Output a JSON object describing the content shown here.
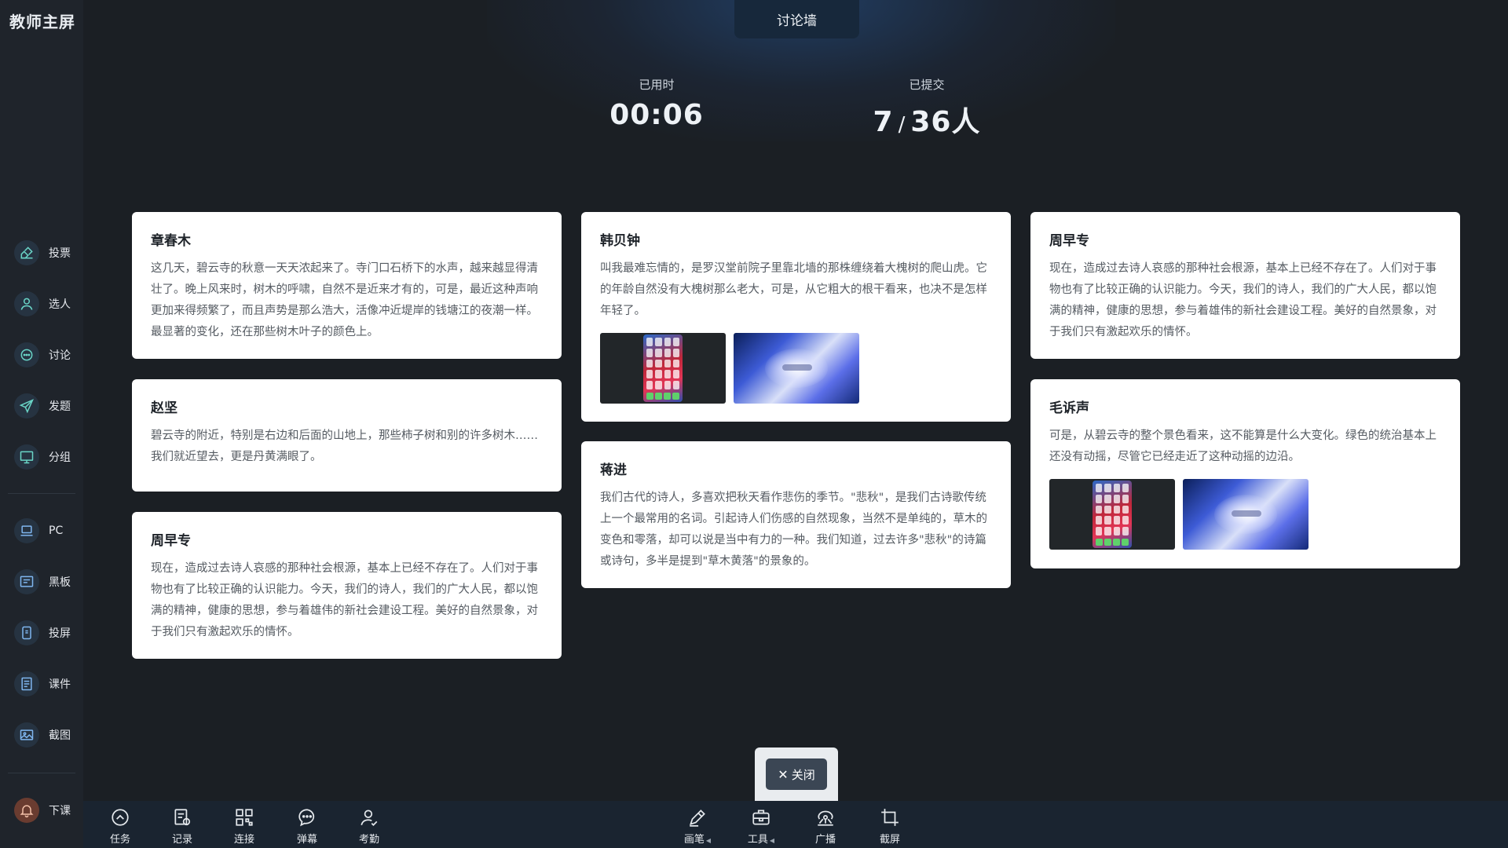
{
  "sidebar": {
    "brand": "教师主屏",
    "items": [
      {
        "label": "投票",
        "icon": "vote-icon"
      },
      {
        "label": "选人",
        "icon": "person-icon"
      },
      {
        "label": "讨论",
        "icon": "chat-icon"
      },
      {
        "label": "发题",
        "icon": "send-icon"
      },
      {
        "label": "分组",
        "icon": "monitor-icon"
      },
      {
        "label": "PC",
        "icon": "laptop-icon"
      },
      {
        "label": "黑板",
        "icon": "blackboard-icon"
      },
      {
        "label": "投屏",
        "icon": "cast-icon"
      },
      {
        "label": "课件",
        "icon": "courseware-icon"
      },
      {
        "label": "截图",
        "icon": "image-icon"
      }
    ],
    "end_class": {
      "label": "下课",
      "icon": "bell-icon"
    }
  },
  "header": {
    "title": "讨论墙",
    "elapsed_label": "已用时",
    "elapsed_value": "00:06",
    "submitted_label": "已提交",
    "submitted_count": "7",
    "submitted_sep": "/",
    "submitted_total": "36人"
  },
  "cards": [
    {
      "name": "章春木",
      "text": "这几天，碧云寺的秋意一天天浓起来了。寺门口石桥下的水声，越来越显得清壮了。晚上风来时，树木的呼啸，自然不是近来才有的，可是，最近这种声响更加来得频繁了，而且声势是那么浩大，活像冲近堤岸的钱塘江的夜潮一样。最显著的变化，还在那些树木叶子的颜色上。"
    },
    {
      "name": "赵坚",
      "text": "碧云寺的附近，特别是右边和后面的山地上，那些柿子树和别的许多树木……我们就近望去，更是丹黄满眼了。"
    },
    {
      "name": "周早专",
      "text": "现在，造成过去诗人哀感的那种社会根源，基本上已经不存在了。人们对于事物也有了比较正确的认识能力。今天，我们的诗人，我们的广大人民，都以饱满的精神，健康的思想，参与着雄伟的新社会建设工程。美好的自然景象，对于我们只有激起欢乐的情怀。"
    },
    {
      "name": "韩贝钟",
      "text": "叫我最难忘情的，是罗汉堂前院子里靠北墙的那株缠绕着大槐树的爬山虎。它的年龄自然没有大槐树那么老大，可是，从它粗大的根干看来，也决不是怎样年轻了。"
    },
    {
      "name": "蒋进",
      "text": "我们古代的诗人，多喜欢把秋天看作悲伤的季节。\"悲秋\"，是我们古诗歌传统上一个最常用的名词。引起诗人们伤感的自然现象，当然不是单纯的，草木的变色和零落，却可以说是当中有力的一种。我们知道，过去许多\"悲秋\"的诗篇或诗句，多半是提到\"草木黄落\"的景象的。"
    },
    {
      "name": "周早专",
      "text": "现在，造成过去诗人哀感的那种社会根源，基本上已经不存在了。人们对于事物也有了比较正确的认识能力。今天，我们的诗人，我们的广大人民，都以饱满的精神，健康的思想，参与着雄伟的新社会建设工程。美好的自然景象，对于我们只有激起欢乐的情怀。"
    },
    {
      "name": "毛诉声",
      "text": "可是，从碧云寺的整个景色看来，这不能算是什么大变化。绿色的统治基本上还没有动摇，尽管它已经走近了这种动摇的边沿。"
    }
  ],
  "close_button": {
    "label": "关闭"
  },
  "toolbar": {
    "left": [
      {
        "label": "任务",
        "icon": "task-icon"
      },
      {
        "label": "记录",
        "icon": "record-icon"
      },
      {
        "label": "连接",
        "icon": "qrcode-icon"
      },
      {
        "label": "弹幕",
        "icon": "danmaku-icon"
      },
      {
        "label": "考勤",
        "icon": "attendance-icon"
      }
    ],
    "right": [
      {
        "label": "画笔",
        "icon": "pen-icon",
        "has_menu": true
      },
      {
        "label": "工具",
        "icon": "toolbox-icon",
        "has_menu": true
      },
      {
        "label": "广播",
        "icon": "broadcast-icon",
        "has_menu": false
      },
      {
        "label": "截屏",
        "icon": "crop-icon",
        "has_menu": false
      }
    ]
  },
  "colors": {
    "background": "#1b1f24",
    "sidebar": "#1f242b",
    "toolbar": "#1a2430",
    "card": "#ffffff",
    "accent_icon": "#5fd0c8"
  }
}
